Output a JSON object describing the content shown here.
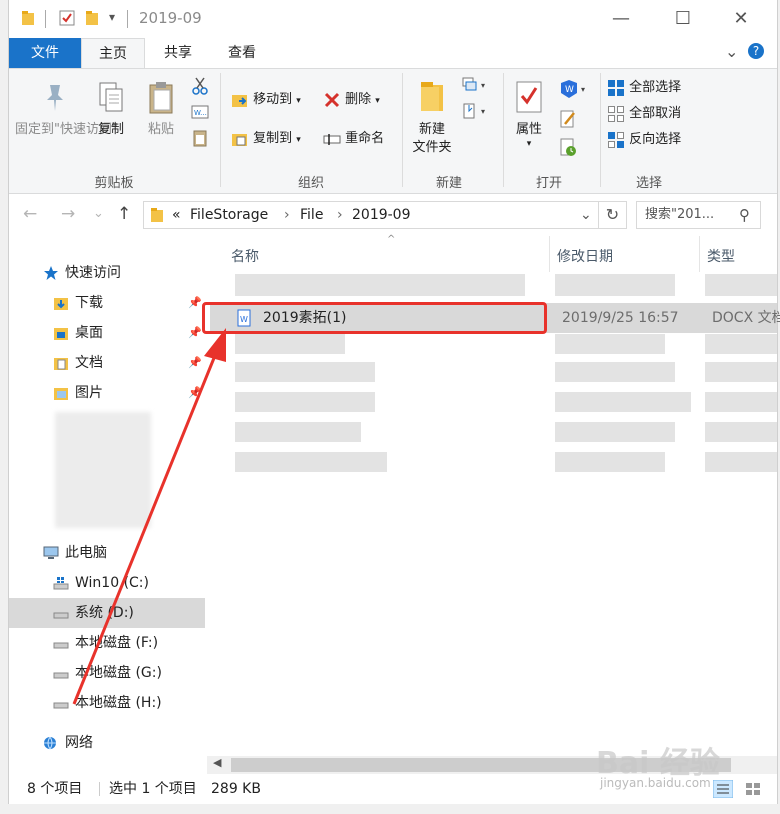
{
  "titlebar": {
    "title": "2019-09",
    "dropdown_glyph": "▾",
    "minimize": "—",
    "maximize": "☐",
    "close": "✕"
  },
  "tabs": {
    "file": "文件",
    "items": [
      "主页",
      "共享",
      "查看"
    ],
    "active": "主页",
    "collapse_glyph": "⌄",
    "help_glyph": "?"
  },
  "ribbon": {
    "clipboard": {
      "pin": "固定到\"快速访问\"",
      "copy": "复制",
      "paste": "粘贴",
      "label": "剪贴板"
    },
    "organize": {
      "move_to": "移动到",
      "copy_to": "复制到",
      "delete": "删除",
      "rename": "重命名",
      "label": "组织"
    },
    "new": {
      "new_folder": "新建\n文件夹",
      "label": "新建"
    },
    "open": {
      "properties": "属性",
      "label": "打开"
    },
    "select": {
      "select_all": "全部选择",
      "select_none": "全部取消",
      "invert": "反向选择",
      "label": "选择"
    }
  },
  "address": {
    "back": "←",
    "forward": "→",
    "recent": "⌄",
    "up": "↑",
    "overflow": "«",
    "crumbs": [
      "FileStorage",
      "File",
      "2019-09"
    ],
    "crumb_sep": "›",
    "dropdown": "⌄",
    "refresh": "↻",
    "search_placeholder": "搜索\"201...",
    "search_glyph": "⚲"
  },
  "nav": {
    "quick_access": "快速访问",
    "quick_items": [
      "下载",
      "桌面",
      "文档",
      "图片"
    ],
    "pin_glyph": "📌",
    "this_pc": "此电脑",
    "drives": [
      "Win10 (C:)",
      "系统 (D:)",
      "本地磁盘 (F:)",
      "本地磁盘 (G:)",
      "本地磁盘 (H:)"
    ],
    "selected_drive": "系统 (D:)",
    "network": "网络"
  },
  "columns": {
    "name": "名称",
    "modified": "修改日期",
    "type": "类型",
    "sort_glyph": "^"
  },
  "selected_file": {
    "name": "2019素拓(1)",
    "modified": "2019/9/25 16:57",
    "type": "DOCX 文档"
  },
  "status": {
    "count": "8 个项目",
    "selection": "选中 1 个项目",
    "size": "289 KB"
  },
  "watermark": {
    "main": "Bai 经验",
    "sub": "jingyan.baidu.com"
  },
  "colors": {
    "accent": "#1a73c9",
    "highlight": "#e8322b",
    "selection": "#d9d9d9"
  }
}
